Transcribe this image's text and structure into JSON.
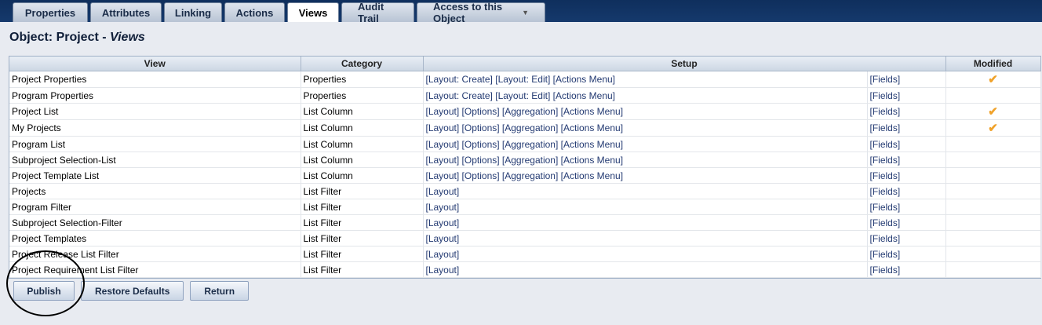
{
  "tabs": [
    {
      "label": "Properties"
    },
    {
      "label": "Attributes"
    },
    {
      "label": "Linking"
    },
    {
      "label": "Actions"
    },
    {
      "label": "Views",
      "active": true
    },
    {
      "label": "Audit Trail"
    },
    {
      "label": "Access to this Object",
      "has_dropdown": true
    }
  ],
  "page": {
    "title_prefix": "Object: Project - ",
    "title_section": "Views"
  },
  "table": {
    "columns": [
      "View",
      "Category",
      "Setup",
      "Modified"
    ],
    "rows": [
      {
        "view": "Project Properties",
        "category": "Properties",
        "setup": [
          "[Layout: Create]",
          "[Layout: Edit]",
          "[Actions Menu]"
        ],
        "fields": "[Fields]",
        "modified": true
      },
      {
        "view": "Program Properties",
        "category": "Properties",
        "setup": [
          "[Layout: Create]",
          "[Layout: Edit]",
          "[Actions Menu]"
        ],
        "fields": "[Fields]",
        "modified": false
      },
      {
        "view": "Project List",
        "category": "List Column",
        "setup": [
          "[Layout]",
          "[Options]",
          "[Aggregation]",
          "[Actions Menu]"
        ],
        "fields": "[Fields]",
        "modified": true
      },
      {
        "view": "My Projects",
        "category": "List Column",
        "setup": [
          "[Layout]",
          "[Options]",
          "[Aggregation]",
          "[Actions Menu]"
        ],
        "fields": "[Fields]",
        "modified": true
      },
      {
        "view": "Program List",
        "category": "List Column",
        "setup": [
          "[Layout]",
          "[Options]",
          "[Aggregation]",
          "[Actions Menu]"
        ],
        "fields": "[Fields]",
        "modified": false
      },
      {
        "view": "Subproject Selection-List",
        "category": "List Column",
        "setup": [
          "[Layout]",
          "[Options]",
          "[Aggregation]",
          "[Actions Menu]"
        ],
        "fields": "[Fields]",
        "modified": false
      },
      {
        "view": "Project Template List",
        "category": "List Column",
        "setup": [
          "[Layout]",
          "[Options]",
          "[Aggregation]",
          "[Actions Menu]"
        ],
        "fields": "[Fields]",
        "modified": false
      },
      {
        "view": "Projects",
        "category": "List Filter",
        "setup": [
          "[Layout]"
        ],
        "fields": "[Fields]",
        "modified": false
      },
      {
        "view": "Program Filter",
        "category": "List Filter",
        "setup": [
          "[Layout]"
        ],
        "fields": "[Fields]",
        "modified": false
      },
      {
        "view": "Subproject Selection-Filter",
        "category": "List Filter",
        "setup": [
          "[Layout]"
        ],
        "fields": "[Fields]",
        "modified": false
      },
      {
        "view": "Project Templates",
        "category": "List Filter",
        "setup": [
          "[Layout]"
        ],
        "fields": "[Fields]",
        "modified": false
      },
      {
        "view": "Project Release List Filter",
        "category": "List Filter",
        "setup": [
          "[Layout]"
        ],
        "fields": "[Fields]",
        "modified": false
      },
      {
        "view": "Project Requirement List Filter",
        "category": "List Filter",
        "setup": [
          "[Layout]"
        ],
        "fields": "[Fields]",
        "modified": false
      }
    ]
  },
  "buttons": {
    "publish": "Publish",
    "restore": "Restore Defaults",
    "return": "Return"
  },
  "icons": {
    "modified": "checkmark-icon",
    "dropdown": "caret-down-icon"
  },
  "colors": {
    "header_bar": "#15396c",
    "check": "#f0a22a",
    "link": "#233a72",
    "background": "#e8ebf1"
  }
}
